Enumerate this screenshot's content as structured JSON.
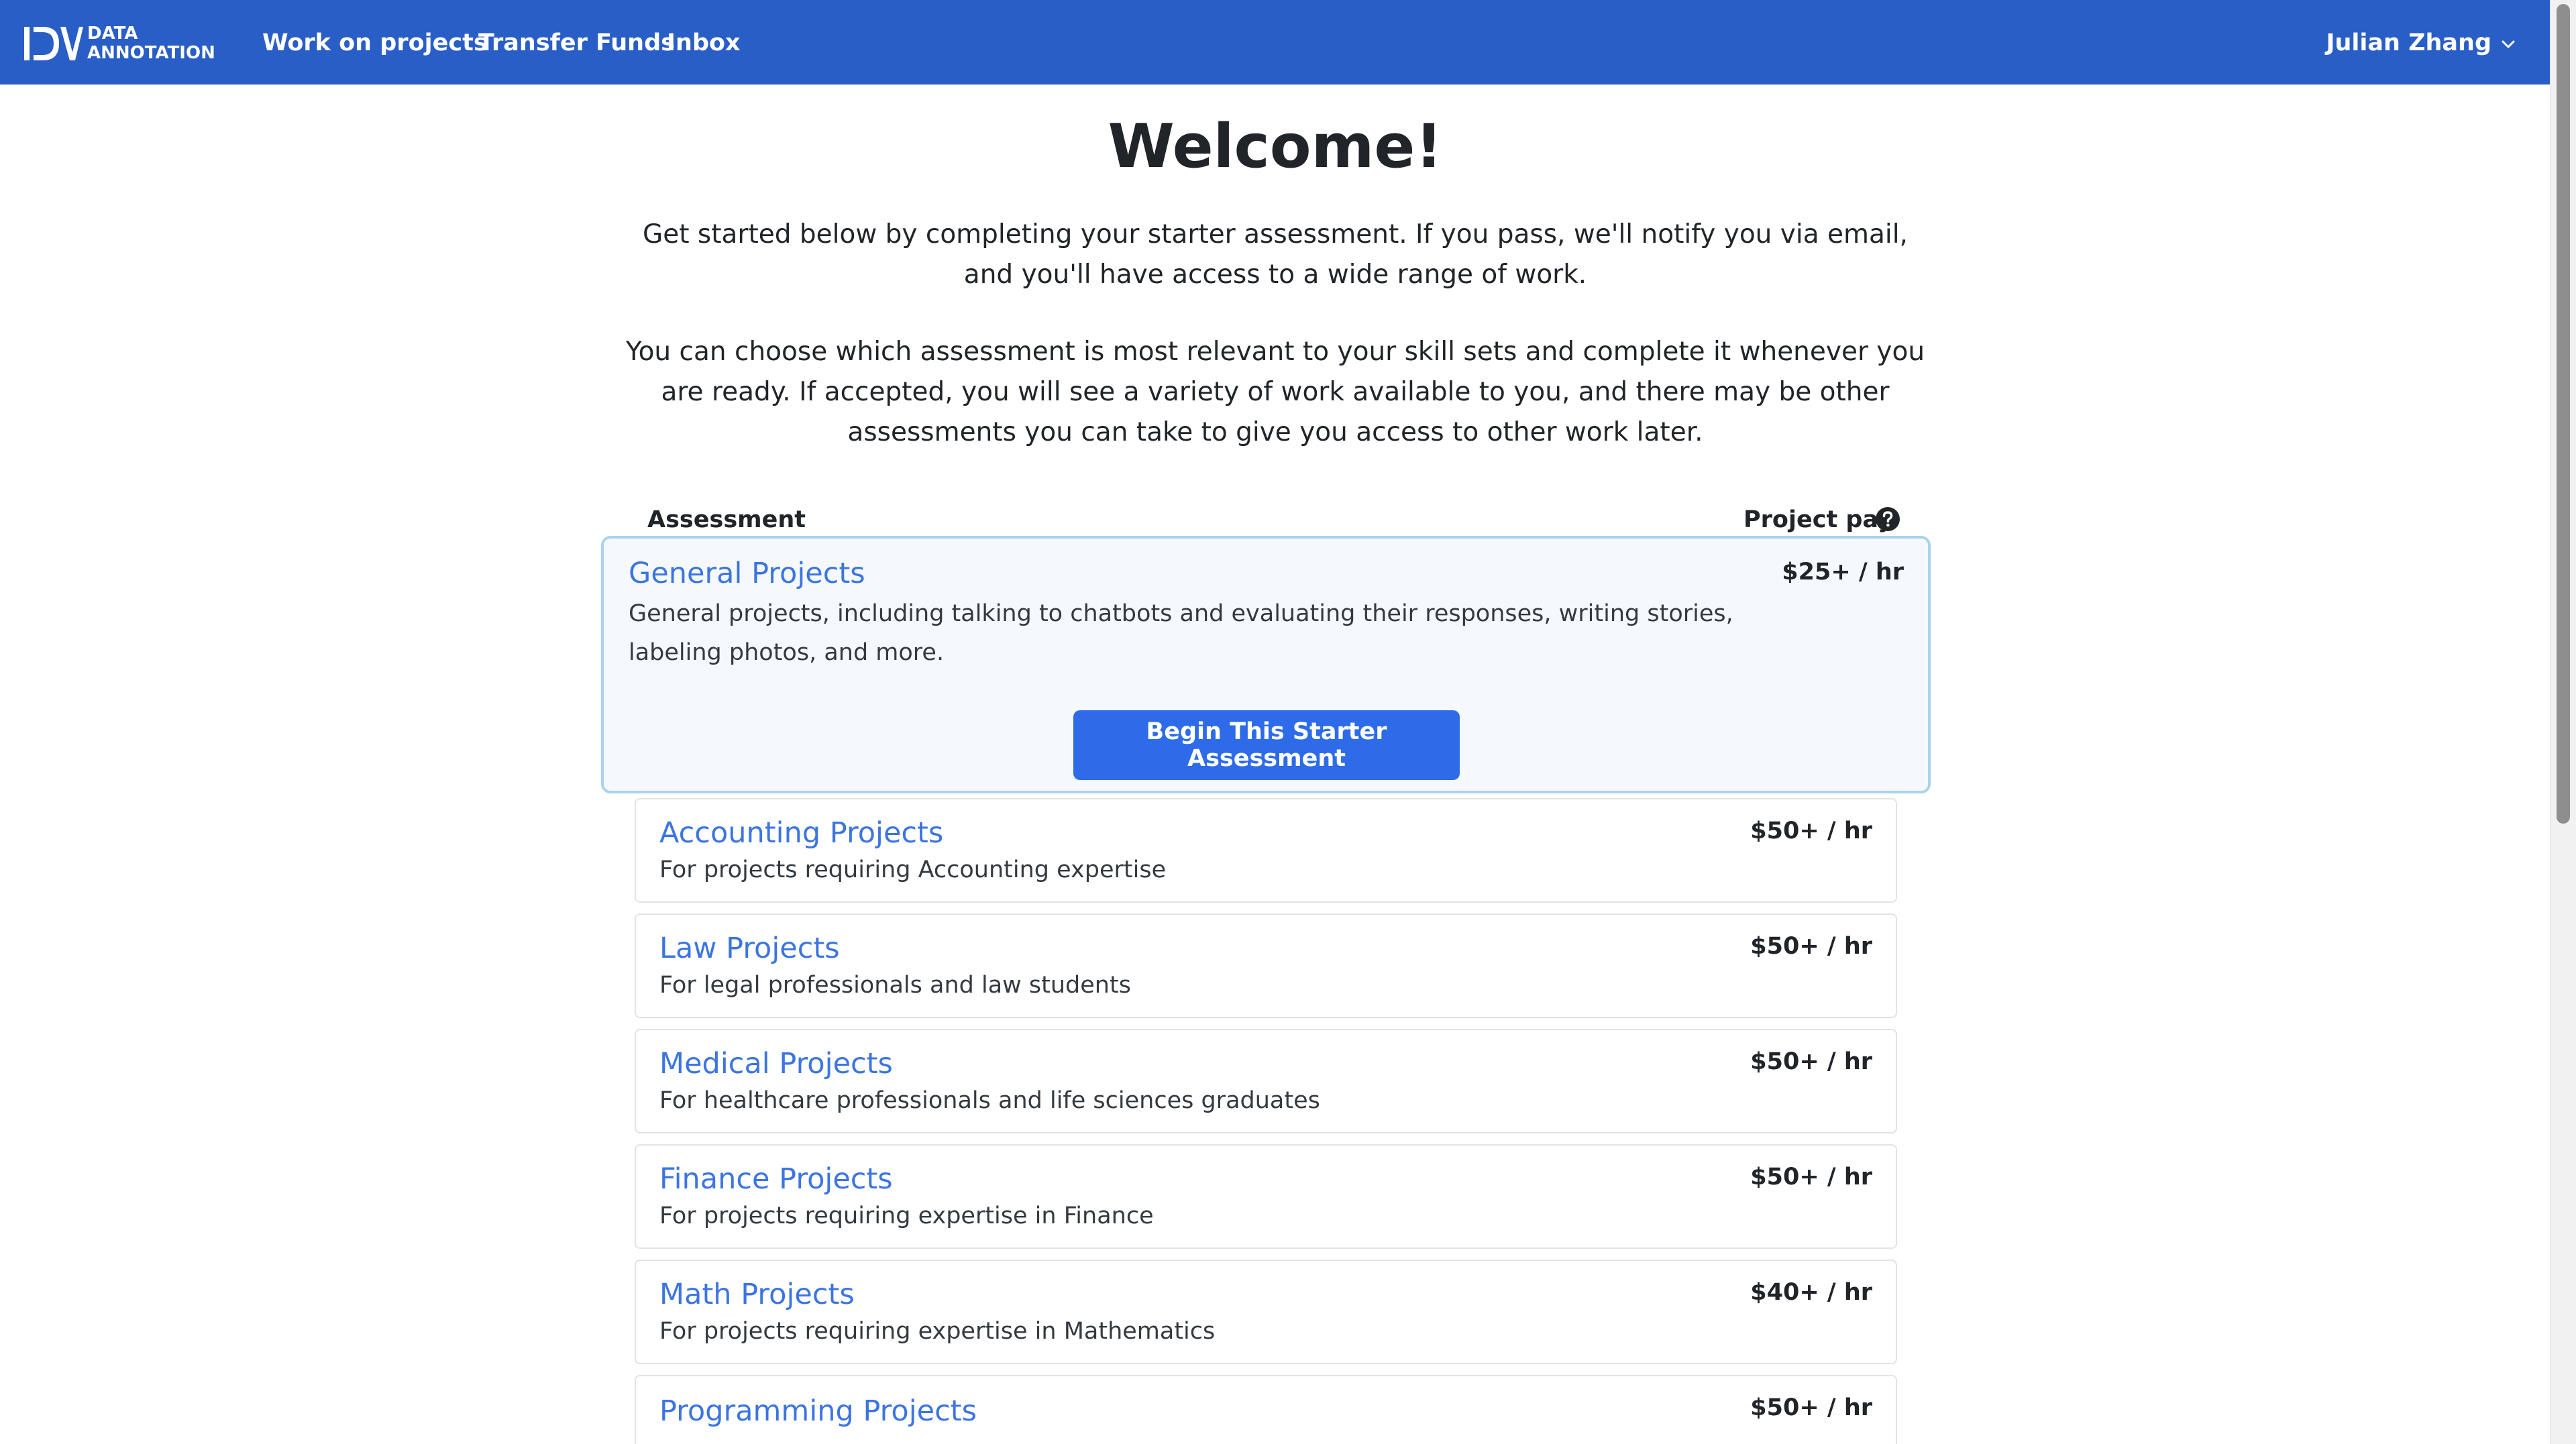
{
  "navbar": {
    "brand_line1": "DATA",
    "brand_line2": "ANNOTATION",
    "links": [
      "Work on projects",
      "Transfer Funds",
      "Inbox"
    ],
    "user_name": "Julian Zhang",
    "background_color": "#2a5ec7"
  },
  "page": {
    "title": "Welcome!",
    "intro_1": "Get started below by completing your starter assessment. If you pass, we'll notify you via email, and you'll have access to a wide range of work.",
    "intro_2": "You can choose which assessment is most relevant to your skill sets and complete it whenever you are ready. If accepted, you will see a variety of work available to you, and there may be other assessments you can take to give you access to other work later."
  },
  "table": {
    "col_assessment": "Assessment",
    "col_pay": "Project pay",
    "help_icon": "question-circle-icon"
  },
  "featured": {
    "title": "General Projects",
    "description": "General projects, including talking to chatbots and evaluating their responses, writing stories, labeling photos, and more.",
    "pay": "$25+ / hr",
    "button_label": "Begin This Starter Assessment"
  },
  "assessments": [
    {
      "title": "Accounting Projects",
      "description": "For projects requiring Accounting expertise",
      "pay": "$50+ / hr"
    },
    {
      "title": "Law Projects",
      "description": "For legal professionals and law students",
      "pay": "$50+ / hr"
    },
    {
      "title": "Medical Projects",
      "description": "For healthcare professionals and life sciences graduates",
      "pay": "$50+ / hr"
    },
    {
      "title": "Finance Projects",
      "description": "For projects requiring expertise in Finance",
      "pay": "$50+ / hr"
    },
    {
      "title": "Math Projects",
      "description": "For projects requiring expertise in Mathematics",
      "pay": "$40+ / hr"
    },
    {
      "title": "Programming Projects",
      "description": "",
      "pay": "$50+ / hr"
    }
  ],
  "colors": {
    "accent": "#2d6be8",
    "link": "#3c75e0",
    "featured_border": "#a9d3ec"
  }
}
